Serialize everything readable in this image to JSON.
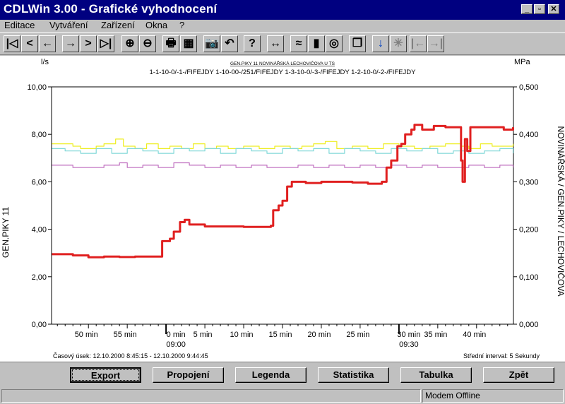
{
  "window": {
    "title": "CDLWin 3.00 - Grafické vyhodnocení",
    "minimize": "_",
    "restore": "▫",
    "close": "✕"
  },
  "menu": [
    "Editace",
    "Vytváření",
    "Zařízení",
    "Okna",
    "?"
  ],
  "toolbar": {
    "buttons": [
      {
        "name": "first-icon",
        "glyph": "|◁"
      },
      {
        "name": "prev-page-icon",
        "glyph": "<"
      },
      {
        "name": "back-icon",
        "glyph": "←"
      },
      {
        "name": "forward-icon",
        "glyph": "→"
      },
      {
        "name": "next-page-icon",
        "glyph": ">"
      },
      {
        "name": "last-icon",
        "glyph": "▷|"
      },
      {
        "name": "zoom-in-icon",
        "glyph": "⊕"
      },
      {
        "name": "zoom-out-icon",
        "glyph": "⊖"
      },
      {
        "name": "print-icon",
        "glyph": "🖶"
      },
      {
        "name": "chart-settings-icon",
        "glyph": "▦"
      },
      {
        "name": "camera-icon",
        "glyph": "📷"
      },
      {
        "name": "undo-icon",
        "glyph": "↶"
      },
      {
        "name": "help-icon",
        "glyph": "?"
      },
      {
        "name": "fit-width-icon",
        "glyph": "↔"
      },
      {
        "name": "line-chart-icon",
        "glyph": "≈"
      },
      {
        "name": "bar-chart-icon",
        "glyph": "▮"
      },
      {
        "name": "chart-3d-icon",
        "glyph": "◎"
      },
      {
        "name": "pages-icon",
        "glyph": "❐"
      },
      {
        "name": "cursor-down-icon",
        "glyph": "↓"
      },
      {
        "name": "cursor-star-icon",
        "glyph": "✳"
      },
      {
        "name": "cursor-left-icon",
        "glyph": "|←"
      },
      {
        "name": "cursor-right-icon",
        "glyph": "→|"
      }
    ]
  },
  "chart": {
    "left_unit": "l/s",
    "right_unit": "MPa",
    "title": "GEN.PIKY 11 NOVINÁŘSKÁ LECHOVIČOVA U TS",
    "subtitle": "1-1-10-0/-1-/FIFEJDY 1-10-00-/251/FIFEJDY 1-3-10-0/-3-/FIFEJDY 1-2-10-0/-2-/FIFEJDY",
    "left_axis_label": "GEN.PIKY 11",
    "right_axis_label": "NOVINÁŘSKÁ / GEN.PIKY / LECHOVIČOVA",
    "footer_left": "Časový úsek: 12.10.2000 8:45:15 - 12.10.2000 9:44:45",
    "footer_right": "Střední interval: 5 Sekundy"
  },
  "chart_data": {
    "type": "line",
    "x_ticks": [
      {
        "t": 50,
        "label": "50 min",
        "major": false
      },
      {
        "t": 55,
        "label": "55 min",
        "major": false
      },
      {
        "t": 60,
        "label": "0 min",
        "sub": "09:00",
        "major": true
      },
      {
        "t": 65,
        "label": "5 min",
        "major": false
      },
      {
        "t": 70,
        "label": "10 min",
        "major": false
      },
      {
        "t": 75,
        "label": "15 min",
        "major": false
      },
      {
        "t": 80,
        "label": "20 min",
        "major": false
      },
      {
        "t": 85,
        "label": "25 min",
        "major": false
      },
      {
        "t": 90,
        "label": "30 min",
        "sub": "09:30",
        "major": true
      },
      {
        "t": 95,
        "label": "35 min",
        "major": false
      },
      {
        "t": 100,
        "label": "40 min",
        "major": false
      }
    ],
    "xlim": [
      45.25,
      104.75
    ],
    "y_left_ticks": [
      "0,00",
      "2,00",
      "4,00",
      "6,00",
      "8,00",
      "10,00"
    ],
    "y_right_ticks": [
      "0,000",
      "0,100",
      "0,200",
      "0,300",
      "0,400",
      "0,500"
    ],
    "ylim_left": [
      0,
      10
    ],
    "ylim_right": [
      0,
      0.5
    ],
    "grid": false,
    "series": [
      {
        "name": "GEN.PIKY 11",
        "axis": "left",
        "color": "#e02020",
        "width": 3,
        "points": [
          [
            45.3,
            2.95
          ],
          [
            48,
            2.9
          ],
          [
            50,
            2.82
          ],
          [
            52,
            2.85
          ],
          [
            54,
            2.83
          ],
          [
            56,
            2.85
          ],
          [
            59.2,
            2.85
          ],
          [
            59.5,
            3.5
          ],
          [
            60.5,
            3.6
          ],
          [
            61,
            3.9
          ],
          [
            61.8,
            4.3
          ],
          [
            62.4,
            4.4
          ],
          [
            63,
            4.2
          ],
          [
            65,
            4.12
          ],
          [
            68,
            4.12
          ],
          [
            70,
            4.1
          ],
          [
            72,
            4.1
          ],
          [
            73.5,
            4.15
          ],
          [
            73.8,
            4.8
          ],
          [
            74.5,
            5.0
          ],
          [
            75,
            5.2
          ],
          [
            75.6,
            5.8
          ],
          [
            76.2,
            6.0
          ],
          [
            78,
            5.95
          ],
          [
            80,
            6.0
          ],
          [
            82,
            6.0
          ],
          [
            84,
            5.97
          ],
          [
            86,
            5.92
          ],
          [
            87.8,
            6.0
          ],
          [
            88.4,
            6.6
          ],
          [
            89,
            6.9
          ],
          [
            89.8,
            7.5
          ],
          [
            90.3,
            7.6
          ],
          [
            90.8,
            8.0
          ],
          [
            91.6,
            8.2
          ],
          [
            92,
            8.4
          ],
          [
            93,
            8.2
          ],
          [
            94,
            8.2
          ],
          [
            94.5,
            8.35
          ],
          [
            96,
            8.3
          ],
          [
            97.8,
            8.3
          ],
          [
            98,
            6.9
          ],
          [
            98.2,
            6.0
          ],
          [
            98.5,
            7.8
          ],
          [
            98.8,
            7.3
          ],
          [
            99.2,
            8.3
          ],
          [
            101,
            8.3
          ],
          [
            102.5,
            8.3
          ],
          [
            103.5,
            8.2
          ],
          [
            104.7,
            8.3
          ]
        ]
      },
      {
        "name": "NOVINÁŘSKÁ",
        "axis": "right",
        "color": "#eeee20",
        "width": 1.2,
        "points": [
          [
            45.3,
            0.38
          ],
          [
            48,
            0.375
          ],
          [
            49,
            0.37
          ],
          [
            51,
            0.375
          ],
          [
            52,
            0.38
          ],
          [
            53.5,
            0.39
          ],
          [
            54.5,
            0.375
          ],
          [
            56,
            0.37
          ],
          [
            57.5,
            0.38
          ],
          [
            59,
            0.37
          ],
          [
            60.5,
            0.375
          ],
          [
            62,
            0.37
          ],
          [
            63.5,
            0.38
          ],
          [
            65,
            0.37
          ],
          [
            66.5,
            0.375
          ],
          [
            68,
            0.37
          ],
          [
            70,
            0.375
          ],
          [
            72,
            0.37
          ],
          [
            74,
            0.375
          ],
          [
            76,
            0.37
          ],
          [
            77.5,
            0.375
          ],
          [
            79,
            0.38
          ],
          [
            80.5,
            0.385
          ],
          [
            82,
            0.37
          ],
          [
            84,
            0.375
          ],
          [
            86,
            0.37
          ],
          [
            88,
            0.38
          ],
          [
            90,
            0.375
          ],
          [
            92,
            0.37
          ],
          [
            94,
            0.375
          ],
          [
            96,
            0.38
          ],
          [
            98,
            0.375
          ],
          [
            99,
            0.37
          ],
          [
            100.5,
            0.38
          ],
          [
            102,
            0.375
          ],
          [
            104.7,
            0.38
          ]
        ]
      },
      {
        "name": "LECHOVIČOVA",
        "axis": "right",
        "color": "#80d8d8",
        "width": 1.2,
        "points": [
          [
            45.3,
            0.37
          ],
          [
            47,
            0.365
          ],
          [
            49,
            0.36
          ],
          [
            51,
            0.37
          ],
          [
            53,
            0.36
          ],
          [
            55,
            0.37
          ],
          [
            57,
            0.365
          ],
          [
            59,
            0.36
          ],
          [
            61,
            0.37
          ],
          [
            63,
            0.365
          ],
          [
            65,
            0.37
          ],
          [
            67,
            0.36
          ],
          [
            69,
            0.37
          ],
          [
            71,
            0.365
          ],
          [
            73,
            0.36
          ],
          [
            75,
            0.37
          ],
          [
            77,
            0.365
          ],
          [
            79,
            0.37
          ],
          [
            81,
            0.36
          ],
          [
            83,
            0.37
          ],
          [
            85,
            0.365
          ],
          [
            87,
            0.36
          ],
          [
            89,
            0.37
          ],
          [
            91,
            0.365
          ],
          [
            93,
            0.37
          ],
          [
            95,
            0.36
          ],
          [
            97,
            0.365
          ],
          [
            99,
            0.36
          ],
          [
            101,
            0.365
          ],
          [
            103,
            0.37
          ],
          [
            104.7,
            0.36
          ]
        ]
      },
      {
        "name": "GEN.PIKY",
        "axis": "right",
        "color": "#c070c0",
        "width": 1.2,
        "points": [
          [
            45.3,
            0.335
          ],
          [
            48,
            0.33
          ],
          [
            50,
            0.33
          ],
          [
            52,
            0.335
          ],
          [
            54,
            0.34
          ],
          [
            55,
            0.33
          ],
          [
            57,
            0.335
          ],
          [
            59,
            0.33
          ],
          [
            61,
            0.34
          ],
          [
            63,
            0.335
          ],
          [
            65,
            0.33
          ],
          [
            67,
            0.335
          ],
          [
            69,
            0.33
          ],
          [
            71,
            0.335
          ],
          [
            73,
            0.33
          ],
          [
            75,
            0.33
          ],
          [
            77,
            0.335
          ],
          [
            79,
            0.33
          ],
          [
            81,
            0.335
          ],
          [
            83,
            0.33
          ],
          [
            85,
            0.335
          ],
          [
            87,
            0.33
          ],
          [
            89,
            0.335
          ],
          [
            91,
            0.33
          ],
          [
            93,
            0.335
          ],
          [
            95,
            0.33
          ],
          [
            97,
            0.33
          ],
          [
            99,
            0.335
          ],
          [
            101,
            0.33
          ],
          [
            103,
            0.335
          ],
          [
            104.7,
            0.33
          ]
        ]
      }
    ]
  },
  "buttons": {
    "export": "Export",
    "propojeni": "Propojení",
    "legenda": "Legenda",
    "statistika": "Statistika",
    "tabulka": "Tabulka",
    "zpet": "Zpět"
  },
  "status": {
    "left": "",
    "right": "Modem Offline"
  }
}
